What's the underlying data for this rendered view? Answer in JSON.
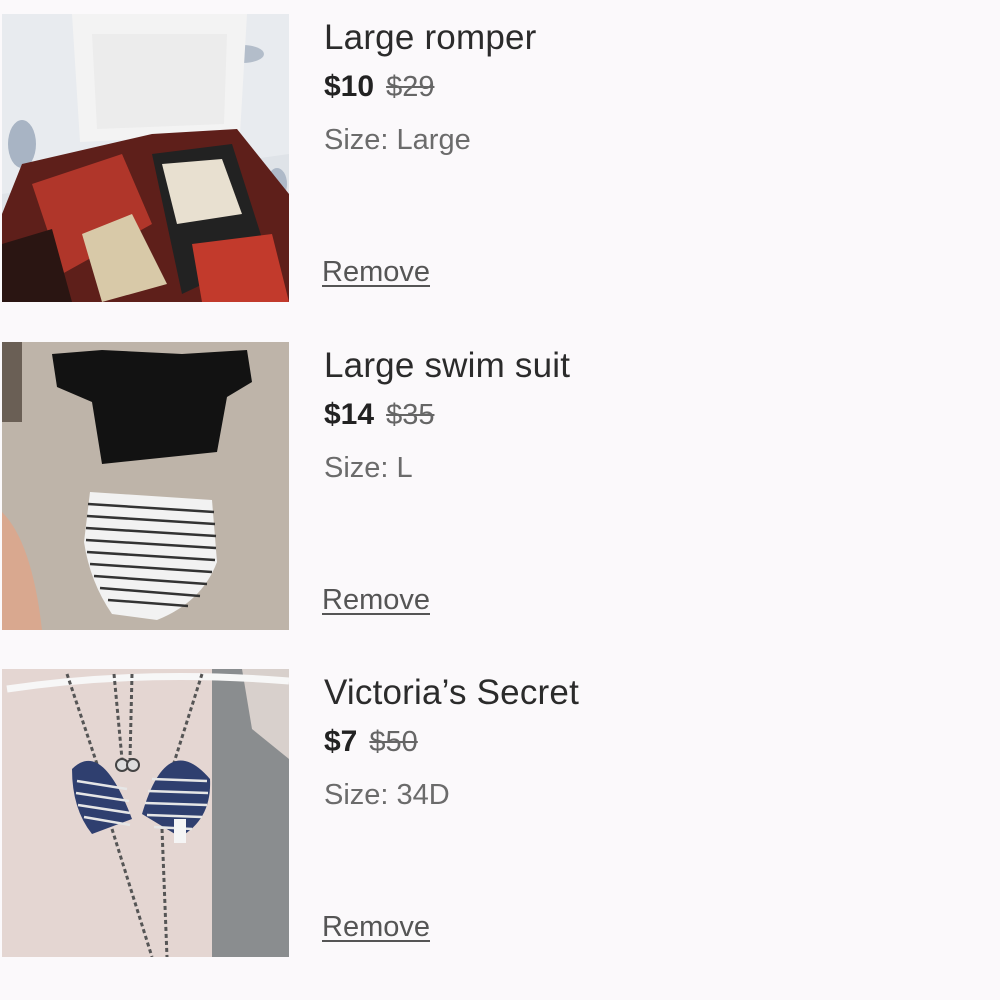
{
  "items": [
    {
      "title": "Large romper",
      "price": "$10",
      "original_price": "$29",
      "size": "Size: Large",
      "remove_label": "Remove"
    },
    {
      "title": "Large swim suit",
      "price": "$14",
      "original_price": "$35",
      "size": "Size: L",
      "remove_label": "Remove"
    },
    {
      "title": "Victoria’s Secret",
      "price": "$7",
      "original_price": "$50",
      "size": "Size: 34D",
      "remove_label": "Remove"
    }
  ],
  "colors": {
    "background": "#fbf9fb",
    "title": "#2b2b2b",
    "muted": "#6b6b6b"
  }
}
